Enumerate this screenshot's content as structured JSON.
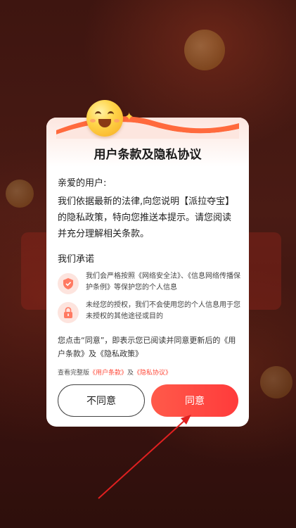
{
  "dialog": {
    "title": "用户条款及隐私协议",
    "greeting": "亲爱的用户:",
    "intro": "我们依据最新的法律,向您说明【派拉夺宝】的隐私政策，特向您推送本提示。请您阅读并充分理解相关条款。",
    "promise_title": "我们承诺",
    "promises": [
      {
        "icon": "shield-icon",
        "text": "我们会严格按照《网络安全法》、《信息网络传播保护条例》等保护您的个人信息"
      },
      {
        "icon": "lock-icon",
        "text": "未经您的授权，我们不会使用您的个人信息用于您未授权的其他途径或目的"
      }
    ],
    "notice": "您点击“同意”，即表示您已阅读并同意更新后的《用户条款》及《隐私政策》",
    "links": {
      "prefix": "查看完整版",
      "user_terms": "《用户条款》",
      "and": "及",
      "privacy": "《隐私协议》"
    },
    "buttons": {
      "disagree": "不同意",
      "agree": "同意"
    }
  },
  "colors": {
    "accent": "#ff4a3a",
    "background": "#3e1510",
    "icon_bg": "#fde4de"
  },
  "decor": {
    "emoji": "smiling-face-icon",
    "sparkle": "sparkle-icon",
    "arrow": "pointer-arrow"
  }
}
